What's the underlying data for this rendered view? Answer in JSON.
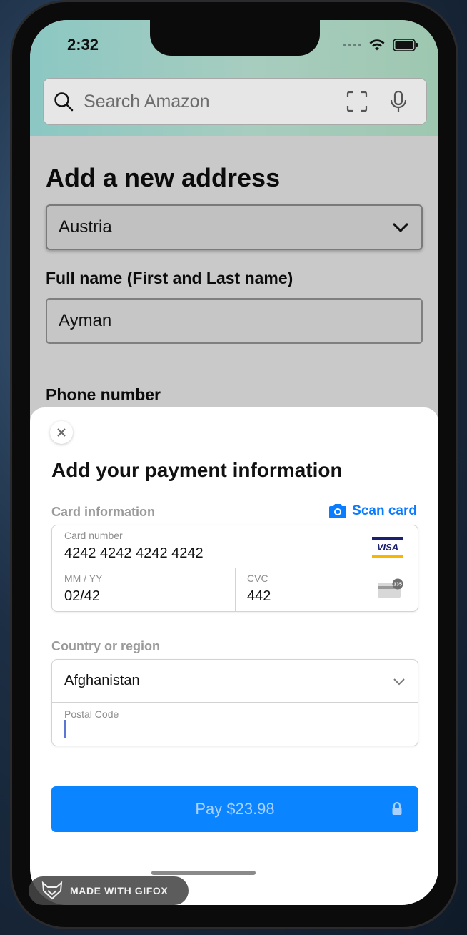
{
  "status_bar": {
    "time": "2:32"
  },
  "search": {
    "placeholder": "Search Amazon"
  },
  "address_form": {
    "title": "Add a new address",
    "country": "Austria",
    "full_name_label": "Full name (First and Last name)",
    "full_name_value": "Ayman",
    "phone_label": "Phone number"
  },
  "payment_sheet": {
    "title": "Add your payment information",
    "card_section_label": "Card information",
    "scan_card_label": "Scan card",
    "card_number_label": "Card number",
    "card_number_value": "4242 4242 4242 4242",
    "card_brand": "VISA",
    "expiry_label": "MM / YY",
    "expiry_value": "02/42",
    "cvc_label": "CVC",
    "cvc_value": "442",
    "cvc_badge": "135",
    "country_section_label": "Country or region",
    "country_value": "Afghanistan",
    "postal_label": "Postal Code",
    "postal_value": "",
    "pay_button_label": "Pay $23.98"
  },
  "watermark": {
    "text": "MADE WITH GIFOX"
  },
  "colors": {
    "accent": "#0a84ff",
    "scan_link": "#0a7cff",
    "visa_blue": "#1a1f71",
    "visa_gold": "#f7b600"
  },
  "icons": [
    "search-icon",
    "scan-icon",
    "microphone-icon",
    "chevron-down-icon",
    "close-icon",
    "camera-icon",
    "visa-logo-icon",
    "cvc-card-icon",
    "lock-icon",
    "wifi-icon",
    "battery-icon",
    "fox-logo-icon"
  ]
}
